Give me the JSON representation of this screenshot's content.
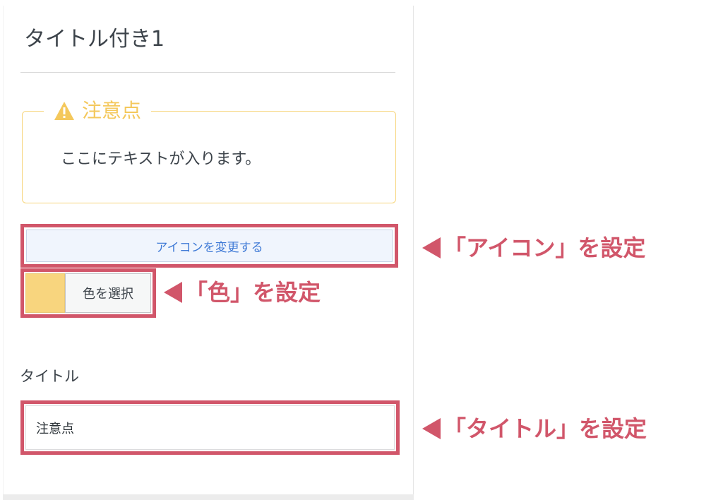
{
  "panel": {
    "title": "タイトル付き1"
  },
  "preview": {
    "heading": "注意点",
    "icon": "warning-icon",
    "body": "ここにテキストが入ります。",
    "accent_color": "#f4c85c"
  },
  "controls": {
    "icon_button_label": "アイコンを変更する",
    "color_button_label": "色を選択",
    "selected_color": "#f8d57e",
    "title_field_label": "タイトル",
    "title_field_value": "注意点"
  },
  "annotations": {
    "icon": "「アイコン」を設定",
    "color": "「色」を設定",
    "title": "「タイトル」を設定",
    "highlight_color": "#d1566a"
  }
}
